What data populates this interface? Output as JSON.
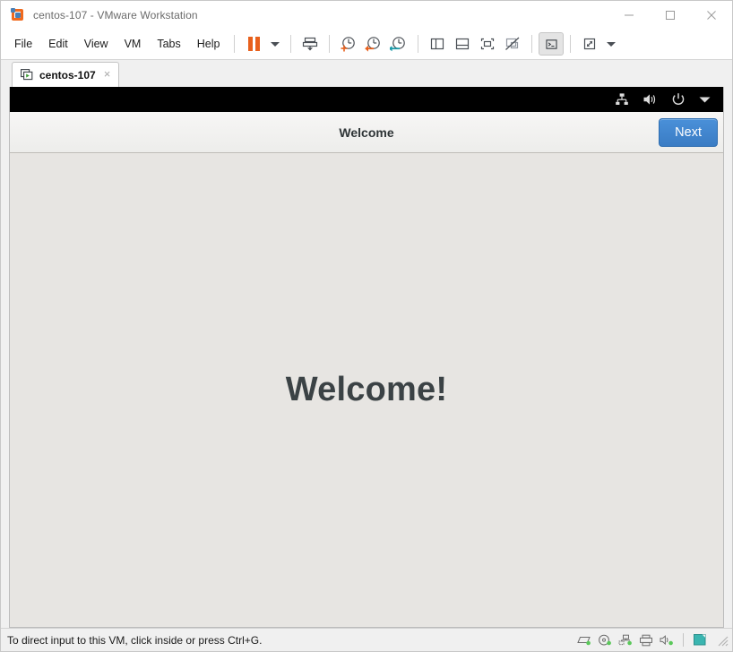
{
  "window": {
    "app_icon": "vmware-logo-icon",
    "title": "centos-107 - VMware Workstation",
    "controls": {
      "minimize": "minimize-icon",
      "maximize": "maximize-icon",
      "close": "close-icon"
    }
  },
  "menu": {
    "items": [
      {
        "label": "File"
      },
      {
        "label": "Edit"
      },
      {
        "label": "View"
      },
      {
        "label": "VM"
      },
      {
        "label": "Tabs"
      },
      {
        "label": "Help"
      }
    ]
  },
  "toolbar": {
    "buttons": [
      {
        "name": "suspend-button",
        "icon": "pause-icon"
      },
      {
        "name": "power-dropdown-button",
        "icon": "chevron-down-icon"
      },
      {
        "name": "manage-vm-button",
        "icon": "send-to-icon"
      },
      {
        "name": "take-snapshot-button",
        "icon": "snapshot-add-icon"
      },
      {
        "name": "revert-snapshot-button",
        "icon": "snapshot-revert-icon"
      },
      {
        "name": "snapshot-manager-button",
        "icon": "snapshot-manager-icon"
      },
      {
        "name": "show-library-button",
        "icon": "sidebar-panel-icon"
      },
      {
        "name": "show-thumbnails-button",
        "icon": "bottom-panel-icon"
      },
      {
        "name": "full-screen-button",
        "icon": "fullscreen-icon"
      },
      {
        "name": "unity-mode-button",
        "icon": "unity-disabled-icon"
      },
      {
        "name": "console-view-button",
        "icon": "terminal-icon",
        "state": "pressed"
      },
      {
        "name": "stretch-guest-button",
        "icon": "expand-arrows-icon"
      },
      {
        "name": "stretch-dropdown-button",
        "icon": "chevron-down-icon"
      }
    ]
  },
  "tabs": [
    {
      "label": "centos-107",
      "icon": "vm-running-icon",
      "close": "×",
      "active": true
    }
  ],
  "guest": {
    "topbar": {
      "icons": [
        {
          "name": "network-icon"
        },
        {
          "name": "volume-icon"
        },
        {
          "name": "power-icon"
        },
        {
          "name": "chevron-down-icon"
        }
      ]
    },
    "header": {
      "title": "Welcome",
      "next_label": "Next"
    },
    "body": {
      "heading": "Welcome!"
    }
  },
  "statusbar": {
    "message": "To direct input to this VM, click inside or press Ctrl+G.",
    "devices": [
      {
        "name": "hard-disk-icon"
      },
      {
        "name": "cd-dvd-icon"
      },
      {
        "name": "network-adapter-icon"
      },
      {
        "name": "printer-icon"
      },
      {
        "name": "sound-card-icon"
      }
    ],
    "indicator": {
      "name": "display-indicator-icon"
    },
    "grip": {
      "name": "resize-grip-icon"
    }
  },
  "colors": {
    "accent_orange": "#e8601c",
    "accent_blue": "#4a90d9",
    "accent_teal": "#1a9aa8",
    "guest_body": "#e7e5e2",
    "guest_topbar": "#000000",
    "icon_gray": "#4a4f55",
    "device_green": "#5ac85a"
  }
}
